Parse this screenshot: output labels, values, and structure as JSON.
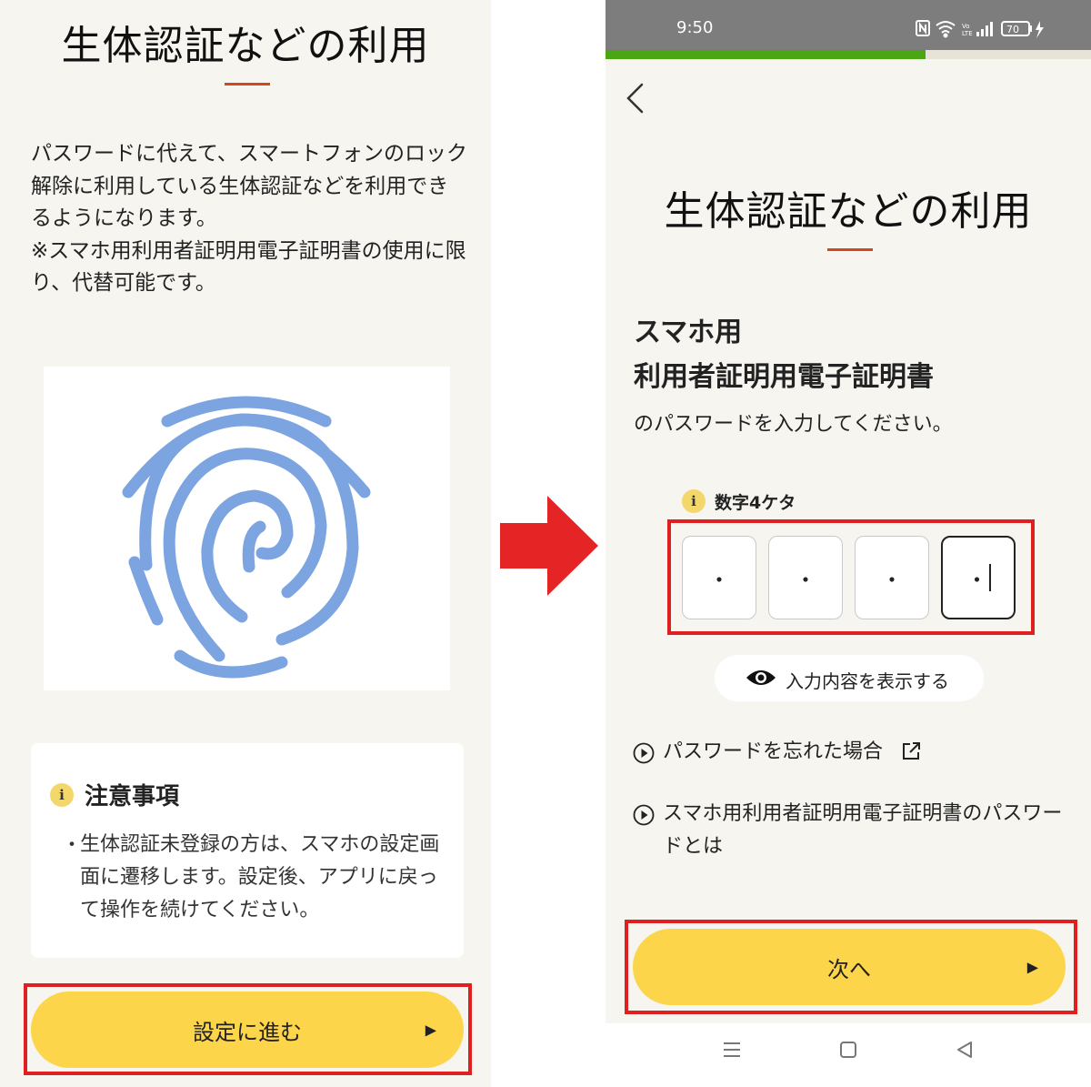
{
  "left_screen": {
    "title": "生体認証などの利用",
    "description": "パスワードに代えて、スマートフォンのロック解除に利用している生体認証などを利用できるようになります。",
    "description_note": "※スマホ用利用者証明用電子証明書の使用に限り、代替可能です。",
    "notice": {
      "title": "注意事項",
      "bullet": "・",
      "body": "生体認証未登録の方は、スマホの設定画面に遷移します。設定後、アプリに戻って操作を続けてください。"
    },
    "button": {
      "label": "設定に進む",
      "arrow": "▶"
    }
  },
  "right_screen": {
    "status_bar": {
      "time": "9:50",
      "battery": "70"
    },
    "progress": 0.66,
    "title": "生体認証などの利用",
    "cert_line1": "スマホ用",
    "cert_line2": "利用者証明用電子証明書",
    "cert_line3": "のパスワードを入力してください。",
    "digits_hint": "数字4ケタ",
    "pin_values": [
      "・",
      "・",
      "・",
      "・"
    ],
    "reveal_label": "入力内容を表示する",
    "links": {
      "forgot": "パスワードを忘れた場合",
      "what_is": "スマホ用利用者証明用電子証明書のパスワードとは"
    },
    "next_button": {
      "label": "次へ",
      "arrow": "▶"
    }
  },
  "info_badge": "i",
  "colors": {
    "background": "#f6f5f0",
    "accent_rule": "#d1491f",
    "button_yellow": "#fdd54a",
    "highlight_red": "#df2020",
    "fingerprint_blue": "#7ba4e0",
    "progress_green": "#4ca512"
  },
  "icons": [
    "fingerprint-icon",
    "info-icon",
    "arrow-right-icon",
    "back-chevron-icon",
    "eye-icon",
    "play-circle-icon",
    "external-link-icon",
    "nav-menu-icon",
    "nav-home-icon",
    "nav-back-icon",
    "wifi-icon",
    "signal-icon",
    "battery-icon",
    "nfc-icon"
  ]
}
